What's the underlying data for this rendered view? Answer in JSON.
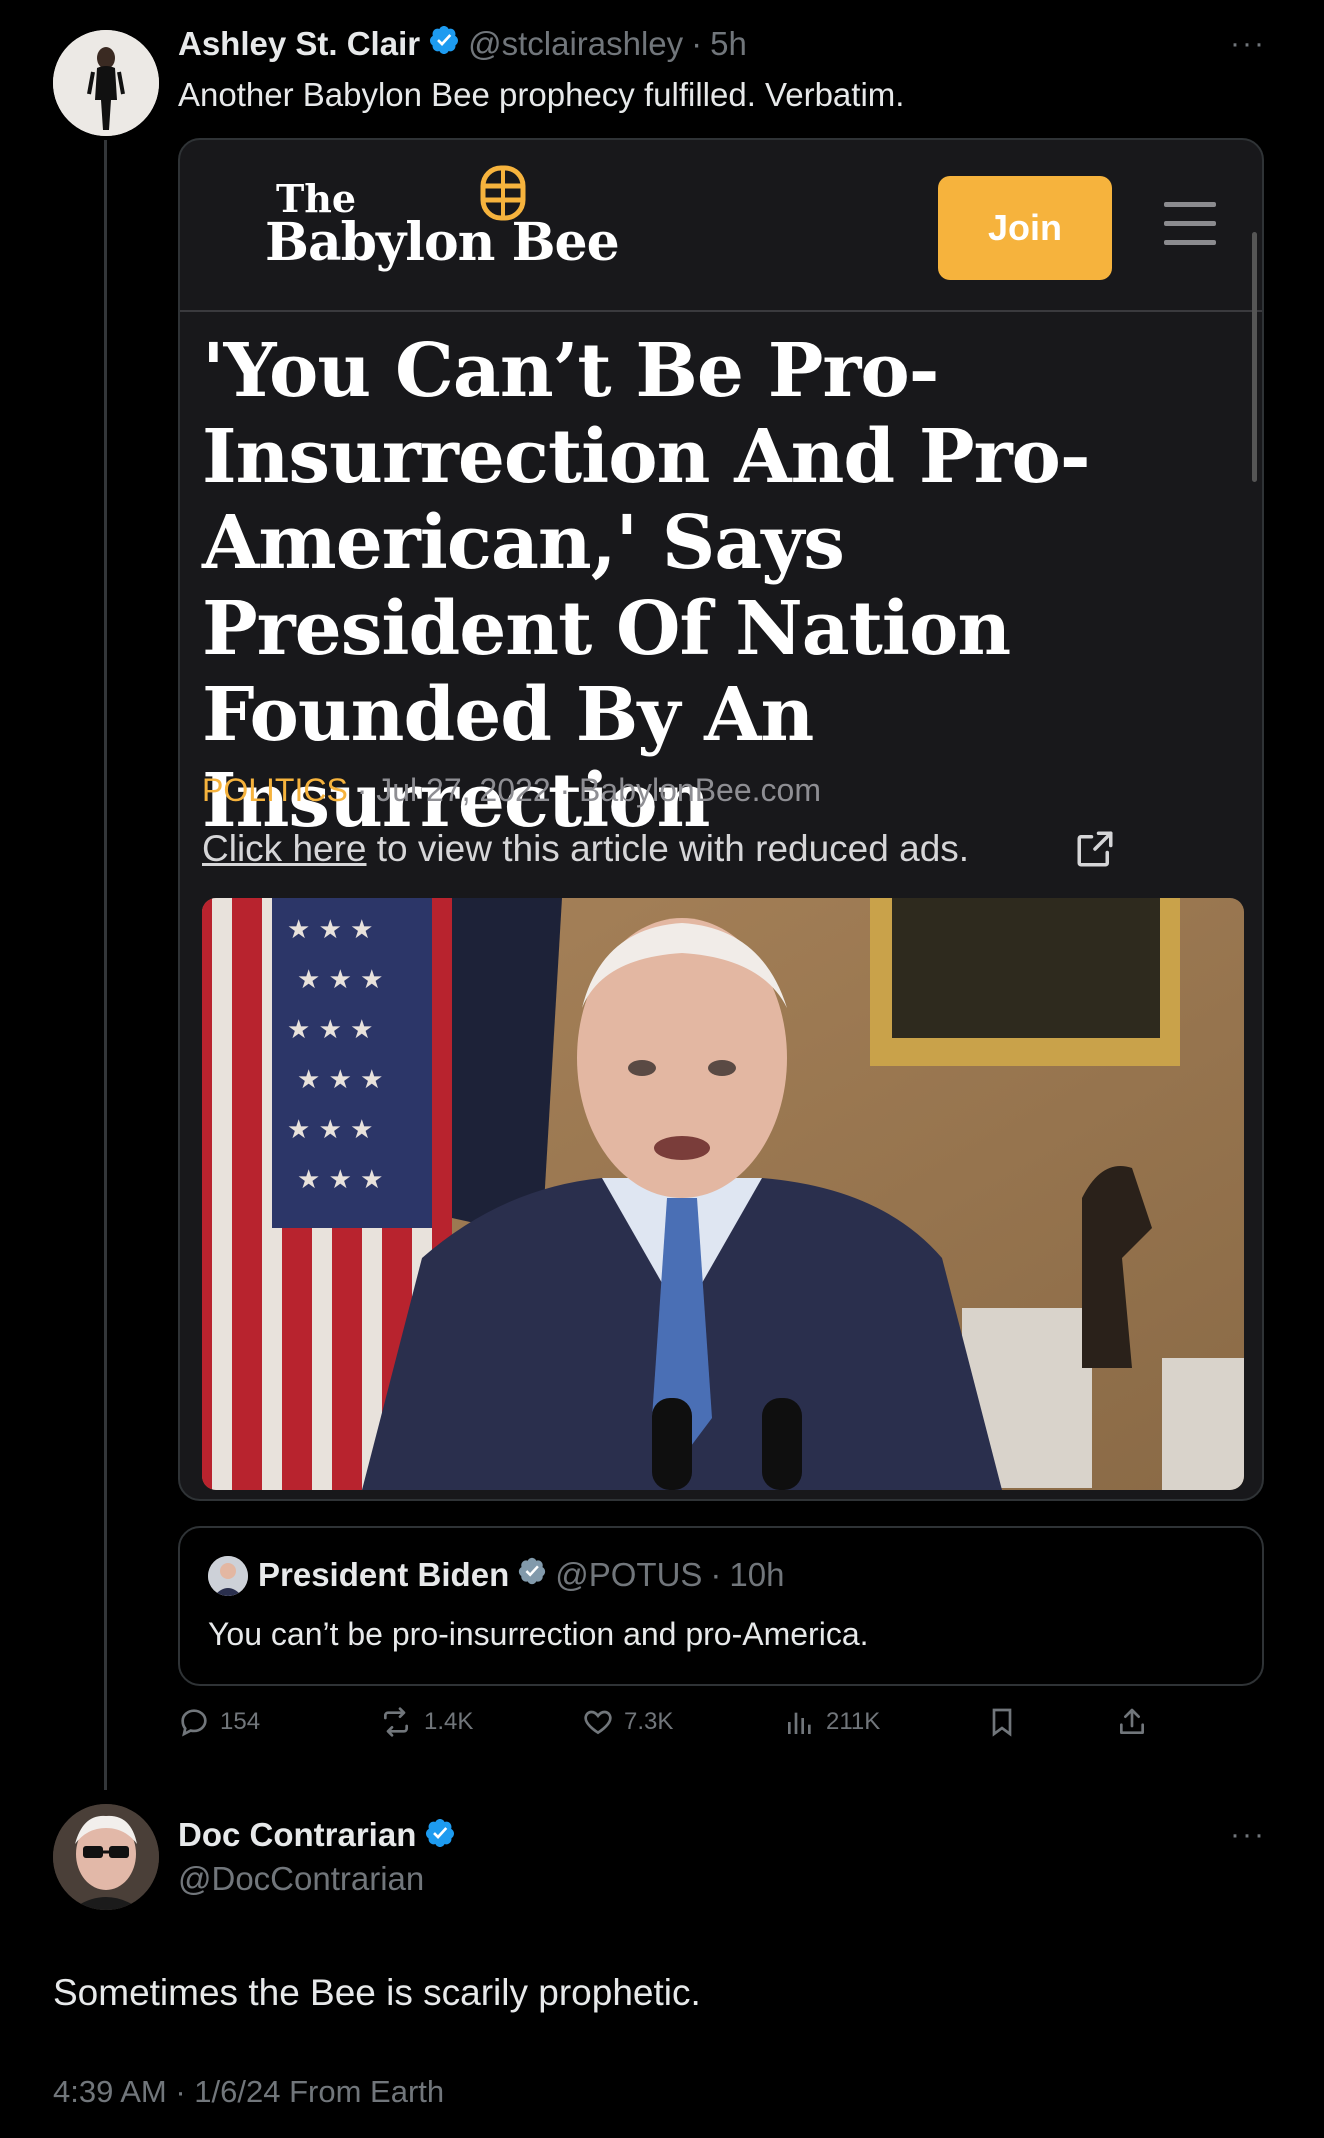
{
  "tweet1": {
    "display_name": "Ashley St. Clair",
    "handle": "@stclairashley",
    "sep": "·",
    "time": "5h",
    "text": "Another Babylon Bee prophecy fulfilled. Verbatim."
  },
  "article": {
    "logo_the": "The",
    "logo_main": "Babylon Bee",
    "join_label": "Join",
    "headline": "'You Can’t Be Pro-Insurrection And Pro-American,' Says President Of Nation Founded By An Insurrection",
    "category": "POLITICS",
    "meta_rest": " · Jul 27, 2022 · BabylonBee.com",
    "click_here": "Click here",
    "reduced_rest": " to view this article with reduced ads."
  },
  "quote": {
    "display_name": "President Biden",
    "handle": "@POTUS",
    "sep": "·",
    "time": "10h",
    "text": "You can’t be pro-insurrection and pro-America."
  },
  "actions": {
    "replies": "154",
    "reposts": "1.4K",
    "likes": "7.3K",
    "views": "211K"
  },
  "tweet2": {
    "display_name": "Doc Contrarian",
    "handle": "@DocContrarian",
    "text": "Sometimes the Bee is scarily prophetic.",
    "timestamp": "4:39 AM · 1/6/24 From Earth"
  },
  "colors": {
    "accent_blue": "#1d9bf0",
    "bee_gold": "#f6b33d",
    "muted": "#71767b"
  }
}
